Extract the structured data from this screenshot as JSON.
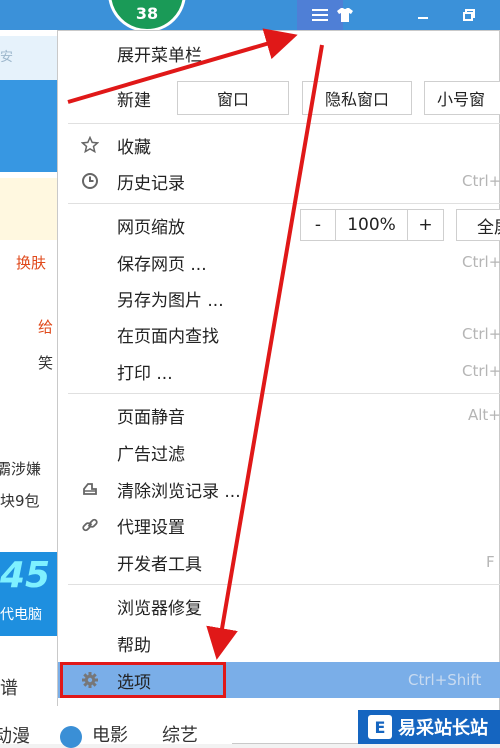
{
  "titlebar": {
    "badge_count": "38"
  },
  "background_page": {
    "url_fragment": "安",
    "text_skin": "换肤",
    "text_gift": "给",
    "text_laugh": "笑",
    "text_news1": "霸涉嫌",
    "text_news2": "块9包",
    "ad_big": "45",
    "ad_small": "代电脑",
    "text_spectrum": "谱",
    "text_anime": "动漫",
    "text_movie": "电影",
    "text_variety": "综艺"
  },
  "menu": {
    "expand_menubar": "展开菜单栏",
    "new_label": "新建",
    "new_window": "窗口",
    "private_window": "隐私窗口",
    "small_window": "小号窗",
    "favorites": "收藏",
    "history": "历史记录",
    "history_shortcut": "Ctrl+",
    "zoom_label": "网页缩放",
    "zoom_minus": "-",
    "zoom_value": "100%",
    "zoom_plus": "+",
    "fullscreen": "全屏",
    "save_page": "保存网页 ...",
    "save_shortcut": "Ctrl+",
    "save_as_image": "另存为图片 ...",
    "find_in_page": "在页面内查找",
    "find_shortcut": "Ctrl+",
    "print": "打印 ...",
    "print_shortcut": "Ctrl+",
    "mute": "页面静音",
    "mute_shortcut": "Alt+",
    "ad_filter": "广告过滤",
    "clear_history": "清除浏览记录 ...",
    "proxy": "代理设置",
    "devtools": "开发者工具",
    "devtools_shortcut": "F",
    "repair": "浏览器修复",
    "help": "帮助",
    "options": "选项",
    "options_shortcut": "Ctrl+Shift"
  },
  "watermark": {
    "logo": "E",
    "text": "易采站长站"
  },
  "annotation_color": "#e01818"
}
